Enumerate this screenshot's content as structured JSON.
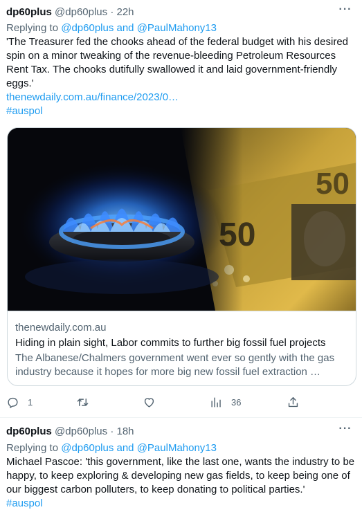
{
  "tweets": [
    {
      "name": "dp60plus",
      "handle": "@dp60plus",
      "separator": "·",
      "time": "22h",
      "reply_prefix": "Replying to",
      "reply_to": "@dp60plus and @PaulMahony13",
      "text": "'The Treasurer fed the chooks ahead of the federal budget with his desired spin on a minor tweaking of the revenue-bleeding Petroleum Resources Rent Tax. The chooks dutifully swallowed it and laid government-friendly eggs.'",
      "link": "thenewdaily.com.au/finance/2023/0…",
      "hashtag": "#auspol",
      "card": {
        "domain": "thenewdaily.com.au",
        "title": "Hiding in plain sight, Labor commits to further big fossil fuel projects",
        "description": "The Albanese/Chalmers government went ever so gently with the gas industry because it hopes for more big new fossil fuel extraction …",
        "image_alt": "gas-burner-flame-and-australian-fifty-dollar-notes"
      },
      "actions": {
        "replies": "1",
        "retweets": "",
        "likes": "",
        "views": "36"
      }
    },
    {
      "name": "dp60plus",
      "handle": "@dp60plus",
      "separator": "·",
      "time": "18h",
      "reply_prefix": "Replying to",
      "reply_to": "@dp60plus and @PaulMahony13",
      "text": "Michael Pascoe: 'this government, like the last one, wants the industry to be happy, to keep exploring & developing new gas fields, to keep being one of our biggest carbon polluters, to keep donating to political parties.'",
      "hashtag": "#auspol"
    }
  ],
  "icons": {
    "more": "more-icon",
    "reply": "reply-icon",
    "retweet": "retweet-icon",
    "like": "heart-icon",
    "views": "views-icon",
    "share": "share-icon"
  },
  "colors": {
    "accent": "#1d9bf0",
    "secondary_text": "#536471",
    "primary_text": "#0f1419",
    "border": "#cfd9de"
  }
}
